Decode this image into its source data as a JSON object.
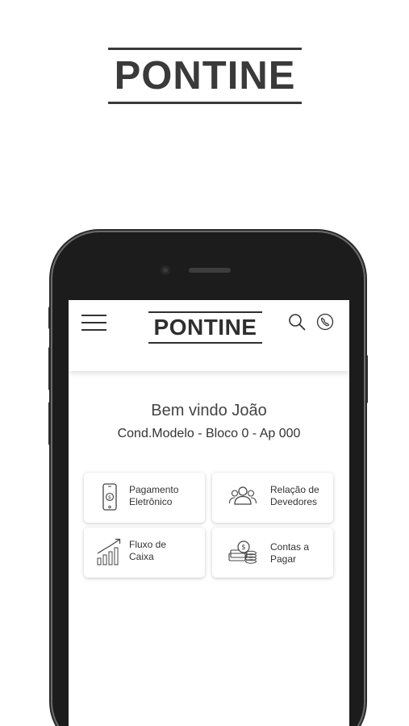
{
  "brand": {
    "name": "PONTINE"
  },
  "app": {
    "brand": "PONTINE",
    "welcome": "Bem vindo João",
    "condo": "Cond.Modelo - Bloco 0 - Ap 000"
  },
  "cards": [
    {
      "line1": "Pagamento",
      "line2": "Eletrônico",
      "icon": "smartphone-payment-icon"
    },
    {
      "line1": "Relação de",
      "line2": "Devedores",
      "icon": "users-group-icon"
    },
    {
      "line1": "Fluxo de",
      "line2": "Caixa",
      "icon": "cash-flow-chart-icon"
    },
    {
      "line1": "Contas a",
      "line2": "Pagar",
      "icon": "money-stack-icon"
    }
  ],
  "colors": {
    "logo": "#3a3a3a",
    "text": "#333333",
    "phone_body": "#1c1c1c"
  }
}
